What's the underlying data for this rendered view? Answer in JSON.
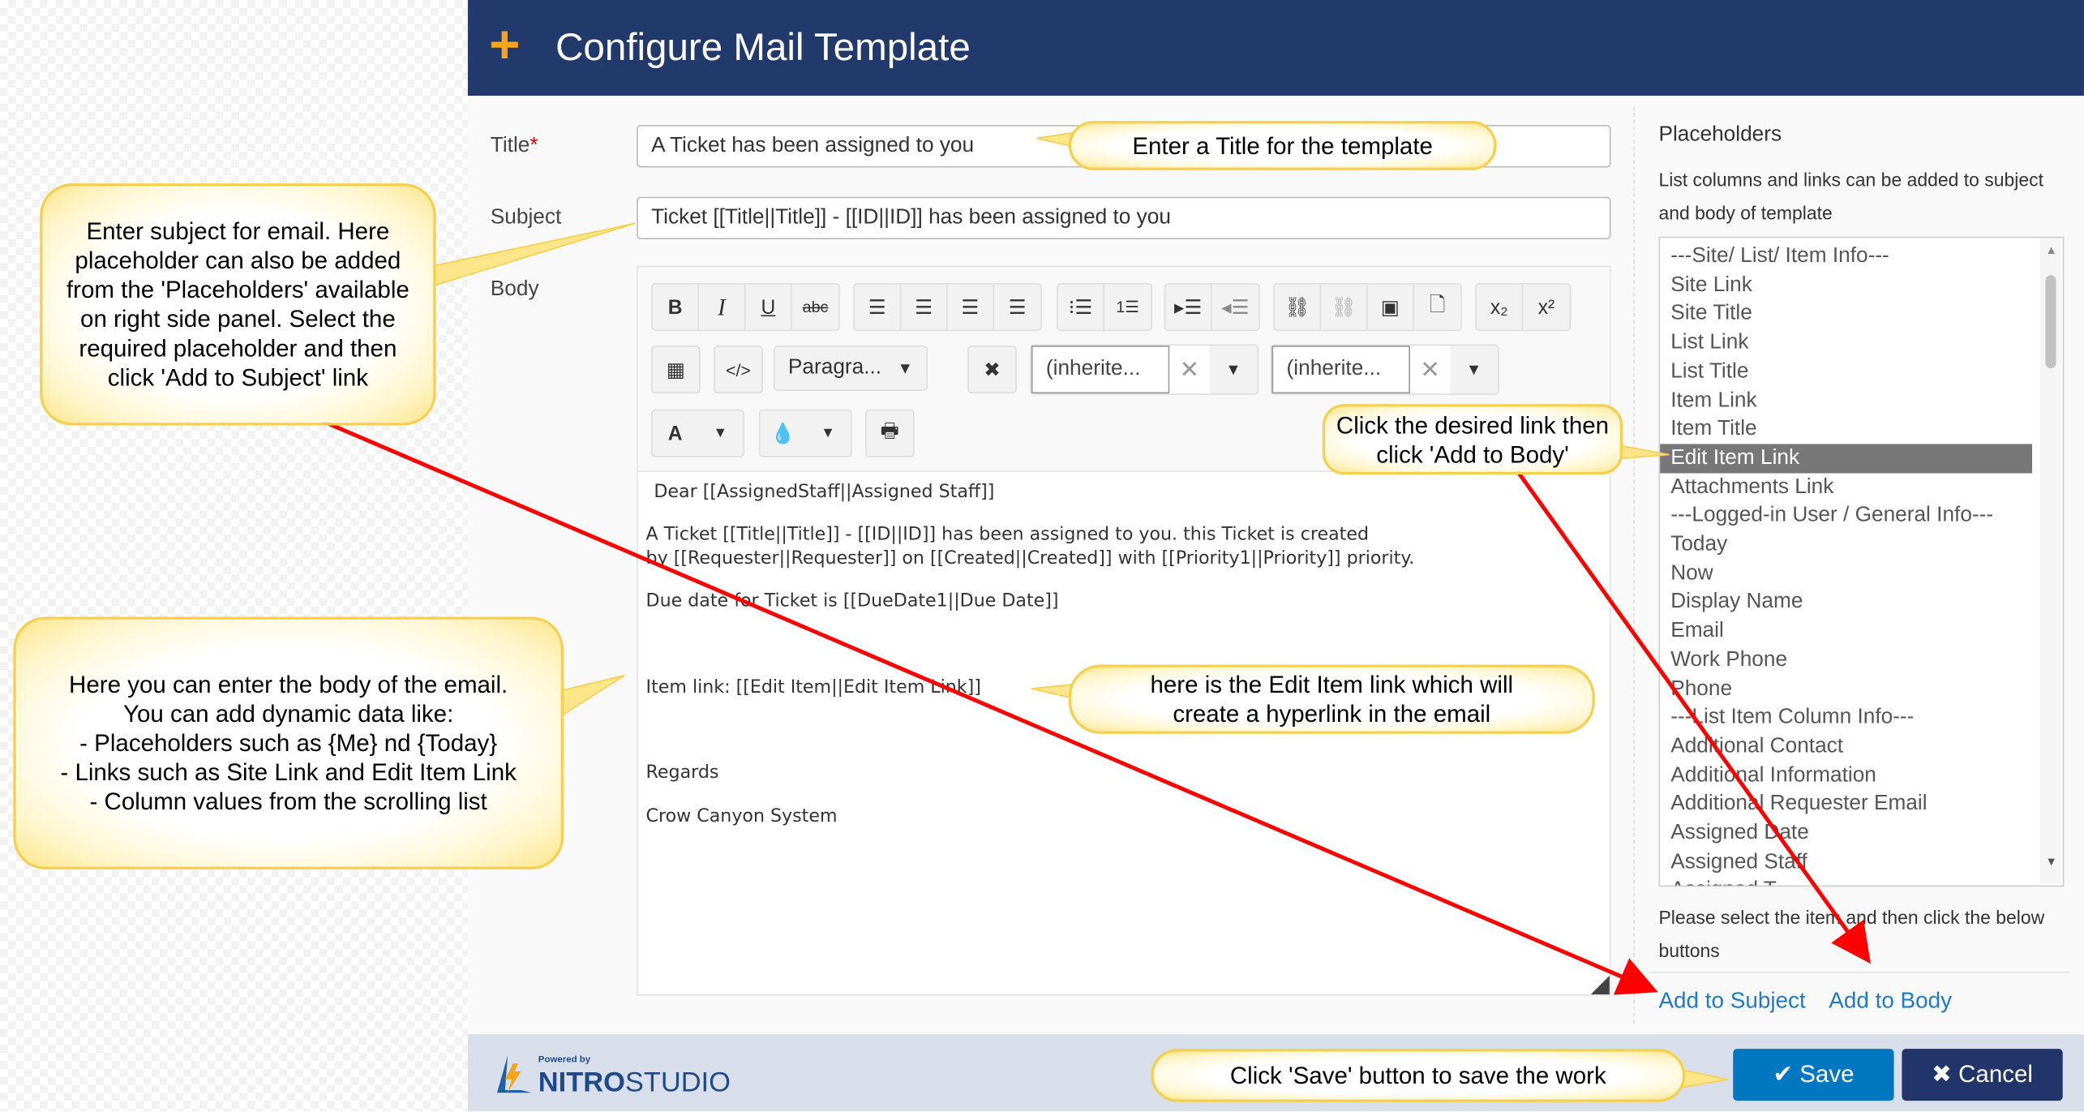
{
  "header": {
    "title": "Configure Mail Template",
    "icon": "plus-icon"
  },
  "form": {
    "title_label": "Title",
    "required_mark": "*",
    "title_value": "A Ticket has been assigned to you",
    "subject_label": "Subject",
    "subject_value": "Ticket [[Title||Title]] - [[ID||ID]] has been assigned to you",
    "body_label": "Body"
  },
  "toolbar": {
    "format_select": "Paragra...",
    "font_family": "(inherite...",
    "font_size": "(inherite...",
    "clear": "✕",
    "dropdown": "▼"
  },
  "body_content": [
    "Dear [[AssignedStaff||Assigned Staff]]",
    "A Ticket [[Title||Title]] - [[ID||ID]] has been assigned to you. this Ticket is created",
    "by [[Requester||Requester]] on [[Created||Created]] with [[Priority1||Priority]] priority.",
    "Due date for Ticket is [[DueDate1||Due Date]]",
    "Item link: [[Edit Item||Edit Item Link]]",
    "Regards",
    "Crow Canyon System"
  ],
  "placeholders": {
    "title": "Placeholders",
    "desc1": "List columns and links can be added to subject",
    "desc2": "and body of template",
    "items": [
      "---Site/ List/ Item Info---",
      "Site Link",
      "Site Title",
      "List Link",
      "List Title",
      "Item Link",
      "Item Title",
      "Edit Item Link",
      "Attachments Link",
      "---Logged-in User / General Info---",
      "Today",
      "Now",
      "Display Name",
      "Email",
      "Work Phone",
      "Phone",
      "---List Item Column Info---",
      "Additional Contact",
      "Additional Information",
      "Additional Requester Email",
      "Assigned Date",
      "Assigned Staff",
      "Assigned T..."
    ],
    "selected": "Edit Item Link",
    "hint1": "Please select the item and then click the below",
    "hint2": "buttons",
    "add_subject": "Add to Subject",
    "add_body": "Add to Body"
  },
  "footer": {
    "powered_by": "Powered by",
    "brand1": "NITRO",
    "brand2": "STUDIO",
    "save": "Save",
    "cancel": "Cancel"
  },
  "callouts": {
    "subject": "Enter subject for email. Here placeholder can also be added from the 'Placeholders' available on right side panel. Select the required placeholder and then click 'Add to Subject' link",
    "title": "Enter a Title for the template",
    "body": "Here you can enter the body of the email. You can add dynamic data like:\n - Placeholders such as {Me} nd {Today}\n - Links such as Site Link and Edit Item Link\n - Column values from the scrolling list",
    "add_body": "Click the desired link then click 'Add to Body'",
    "edit_link": "here is the Edit Item link which will create a hyperlink in the email",
    "save": "Click 'Save' button to save the work"
  },
  "colors": {
    "header": "#213a6b",
    "accent": "#f3a51b",
    "save": "#0077c0",
    "cancel": "#22356b",
    "link": "#1f7ac7",
    "arrow": "#ff0000"
  }
}
